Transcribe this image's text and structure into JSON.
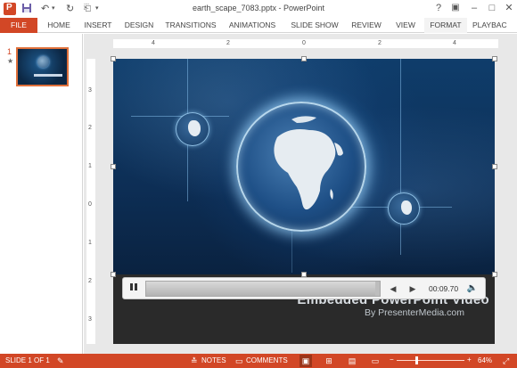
{
  "window": {
    "title": "earth_scape_7083.pptx - PowerPoint",
    "help": "?",
    "restore_icon": "restore-ribbon-icon",
    "minimize": "–",
    "maximize": "□"
  },
  "qat": {
    "save": "save-icon",
    "undo": "↶",
    "redo": "↻"
  },
  "tabs": [
    {
      "label": "FILE"
    },
    {
      "label": "HOME"
    },
    {
      "label": "INSERT"
    },
    {
      "label": "DESIGN"
    },
    {
      "label": "TRANSITIONS"
    },
    {
      "label": "ANIMATIONS"
    },
    {
      "label": "SLIDE SHOW"
    },
    {
      "label": "REVIEW"
    },
    {
      "label": "VIEW"
    },
    {
      "label": "FORMAT"
    },
    {
      "label": "PLAYBAC"
    }
  ],
  "thumbnails": {
    "number": "1",
    "star": "★"
  },
  "ruler": {
    "h_ticks": [
      "4",
      "2",
      "0",
      "2",
      "4"
    ],
    "v_ticks": [
      "3",
      "2",
      "1",
      "0",
      "1",
      "2",
      "3"
    ]
  },
  "slide": {
    "title": "Embedded PowerPoint Video",
    "subtitle": "By PresenterMedia.com"
  },
  "video": {
    "time": "00:09.70",
    "progress_fraction": 0.98,
    "play_icon": "pause-icon",
    "back_icon": "step-back-icon",
    "forward_icon": "step-forward-icon",
    "volume_icon": "volume-icon"
  },
  "status": {
    "slide_info": "SLIDE 1 OF 1",
    "notes": "NOTES",
    "comments": "COMMENTS",
    "zoom": "64%",
    "minus": "−",
    "plus": "+"
  },
  "colors": {
    "accent": "#d24726",
    "slide_bg": "#0d2a4a"
  }
}
